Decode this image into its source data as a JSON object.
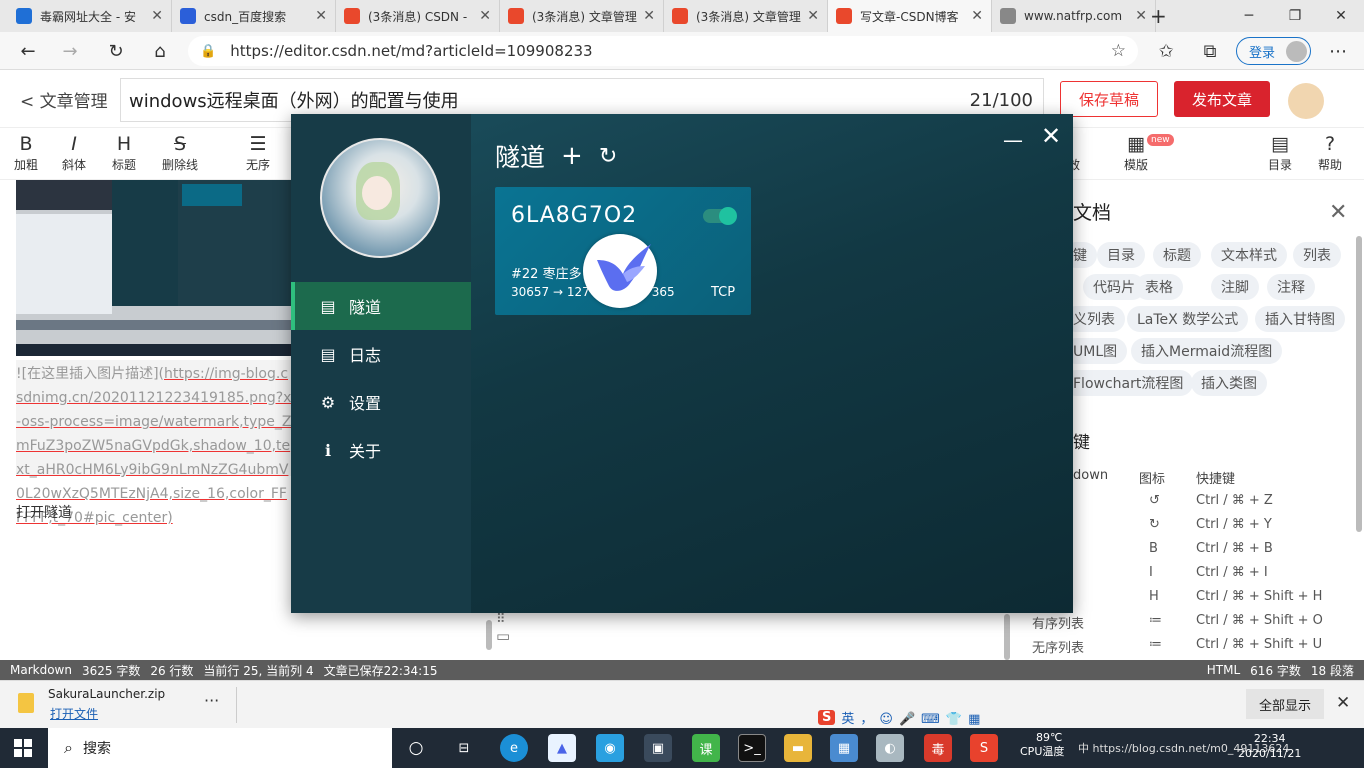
{
  "browser": {
    "tabs": [
      {
        "title": "毒霸网址大全 - 安",
        "icon": "kingsoft-icon",
        "color": "#1f6fd6"
      },
      {
        "title": "csdn_百度搜索",
        "icon": "baidu-paw-icon",
        "color": "#2b5fd9"
      },
      {
        "title": "(3条消息) CSDN -",
        "icon": "csdn-icon",
        "color": "#e9482c"
      },
      {
        "title": "(3条消息) 文章管理",
        "icon": "csdn-icon",
        "color": "#e9482c"
      },
      {
        "title": "(3条消息) 文章管理",
        "icon": "csdn-icon",
        "color": "#e9482c"
      },
      {
        "title": "写文章-CSDN博客",
        "icon": "csdn-icon",
        "color": "#e9482c"
      },
      {
        "title": "www.natfrp.com",
        "icon": "page-icon",
        "color": "#888888"
      }
    ],
    "url": "https://editor.csdn.net/md?articleId=109908233",
    "login_label": "登录"
  },
  "editor": {
    "back_label": "文章管理",
    "article_title": "windows远程桌面（外网）的配置与使用",
    "title_count": "21/100",
    "save_label": "保存草稿",
    "publish_label": "发布文章",
    "toolbar_left": [
      {
        "glyph": "B",
        "label": "加粗"
      },
      {
        "glyph": "I",
        "label": "斜体"
      },
      {
        "glyph": "H",
        "label": "标题"
      },
      {
        "glyph": "S",
        "label": "删除线"
      },
      {
        "glyph": "☰",
        "label": "无序"
      }
    ],
    "toolbar_right": [
      {
        "glyph": "▦",
        "label": "模版"
      },
      {
        "glyph": "▤",
        "label": "目录"
      },
      {
        "glyph": "?",
        "label": "帮助"
      }
    ],
    "toolbar_partial": "效",
    "new_badge": "new",
    "md_text_1": "![在这里插入图片描述](",
    "md_link": "https://img-blog.csdnimg.cn/20201121223419185.png?x-oss-process=image/watermark,type_ZmFuZ3poZW5naGVpdGk,shadow_10,text_aHR0cHM6Ly9ibG9nLmNzZG4ubmV0L20wXzQ5MTEzNjA4,size_16,color_FFFFFF,t_70#pic_center)",
    "body_text": "打开隧道"
  },
  "help": {
    "title": "文档",
    "chips": [
      "键",
      "目录",
      "标题",
      "文本样式",
      "列表",
      "",
      "代码片",
      "表格",
      "注脚",
      "注释",
      "义列表",
      "LaTeX 数学公式",
      "插入甘特图",
      "UML图",
      "插入Mermaid流程图",
      "Flowchart流程图",
      "插入类图"
    ],
    "section2": "键",
    "headers": [
      "down",
      "图标",
      "快捷键"
    ],
    "shortcuts": [
      {
        "name": "",
        "icon": "↺",
        "keys": "Ctrl / ⌘ + Z"
      },
      {
        "name": "",
        "icon": "↻",
        "keys": "Ctrl / ⌘ + Y"
      },
      {
        "name": "",
        "icon": "B",
        "keys": "Ctrl / ⌘ + B"
      },
      {
        "name": "",
        "icon": "I",
        "keys": "Ctrl / ⌘ + I"
      },
      {
        "name": "",
        "icon": "H",
        "keys": "Ctrl / ⌘ + Shift + H"
      },
      {
        "name": "有序列表",
        "icon": "≔",
        "keys": "Ctrl / ⌘ + Shift + O"
      },
      {
        "name": "无序列表",
        "icon": "≔",
        "keys": "Ctrl / ⌘ + Shift + U"
      }
    ]
  },
  "statusbar": {
    "mode": "Markdown",
    "chars": "3625 字数",
    "lines": "26 行数",
    "position": "当前行 25, 当前列 4",
    "saved": "文章已保存22:34:15",
    "html_label": "HTML",
    "html_chars": "616 字数",
    "paragraphs": "18 段落"
  },
  "download": {
    "filename": "SakuraLauncher.zip",
    "open_label": "打开文件",
    "more": "···",
    "show_all": "全部显示",
    "ime": [
      "英",
      "，",
      "☺",
      "🎤",
      "⌨",
      "👕",
      "▦"
    ]
  },
  "taskbar": {
    "search_placeholder": "搜索",
    "temp": "89℃",
    "temp_label": "CPU温度",
    "tray_text": "中 https://blog.csdn.net/m0_49113624",
    "time": "22:34",
    "date": "2020/11/21"
  },
  "launcher": {
    "nav": [
      {
        "label": "隧道",
        "icon": "server-icon",
        "glyph": "▤",
        "active": true
      },
      {
        "label": "日志",
        "icon": "log-icon",
        "glyph": "▤",
        "active": false
      },
      {
        "label": "设置",
        "icon": "gear-icon",
        "glyph": "⚙",
        "active": false
      },
      {
        "label": "关于",
        "icon": "info-icon",
        "glyph": "ℹ",
        "active": false
      }
    ],
    "heading": "隧道",
    "add": "+",
    "refresh": "↻",
    "tunnel": {
      "name": "6LA8G7O2",
      "node": "#22 枣庄多",
      "ports": "30657 → 127",
      "ports_tail": "365",
      "protocol": "TCP",
      "enabled": true
    },
    "accent": "#2fbf7e"
  }
}
